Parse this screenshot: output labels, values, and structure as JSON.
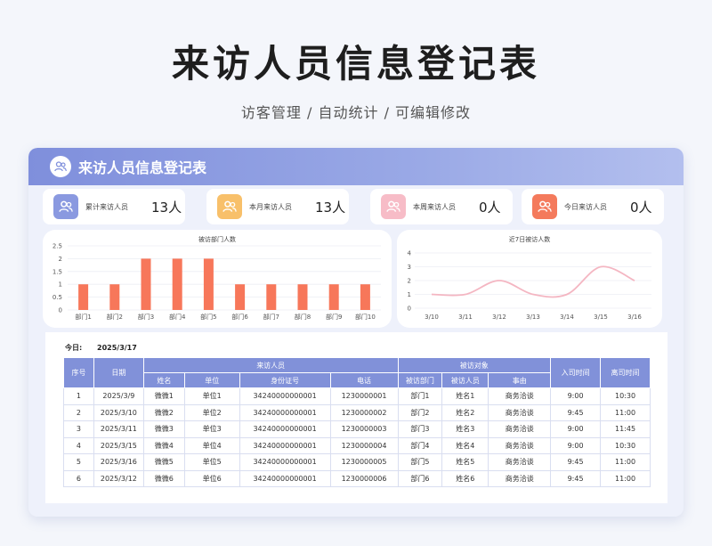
{
  "hero": {
    "title": "来访人员信息登记表",
    "subtitle": "访客管理 / 自动统计 /  可编辑修改"
  },
  "panel": {
    "title": "来访人员信息登记表"
  },
  "stats": [
    {
      "label": "累计来访人员",
      "value": "13人",
      "icon": "users-icon",
      "color": "#7f8fdc"
    },
    {
      "label": "本月来访人员",
      "value": "13人",
      "icon": "users-icon",
      "color": "#f7b955"
    },
    {
      "label": "本周来访人员",
      "value": "0人",
      "icon": "users-icon",
      "color": "#f6a9b8"
    },
    {
      "label": "今日来访人员",
      "value": "0人",
      "icon": "users-icon",
      "color": "#f47a5c"
    }
  ],
  "chart_data": [
    {
      "type": "bar",
      "title": "被访部门人数",
      "categories": [
        "部门1",
        "部门2",
        "部门3",
        "部门4",
        "部门5",
        "部门6",
        "部门7",
        "部门8",
        "部门9",
        "部门10"
      ],
      "values": [
        1,
        1,
        2,
        2,
        2,
        1,
        1,
        1,
        1,
        1
      ],
      "yticks": [
        "0",
        "0.5",
        "1",
        "1.5",
        "2",
        "2.5"
      ],
      "ylim": [
        0,
        2.5
      ],
      "color": "#f7775a",
      "grid": true
    },
    {
      "type": "line",
      "title": "近7日被访人数",
      "categories": [
        "3/10",
        "3/11",
        "3/12",
        "3/13",
        "3/14",
        "3/15",
        "3/16"
      ],
      "values": [
        1,
        1,
        2,
        1,
        1,
        3,
        2
      ],
      "yticks": [
        "0",
        "1",
        "2",
        "3",
        "4"
      ],
      "ylim": [
        0,
        4
      ],
      "color": "#f4b6c2",
      "grid": true
    }
  ],
  "table": {
    "today_label": "今日:",
    "today_value": "2025/3/17",
    "headers": {
      "index": "序号",
      "date": "日期",
      "visitor_group": "来访人员",
      "name": "姓名",
      "unit": "单位",
      "id": "身份证号",
      "phone": "电话",
      "target_group": "被访对象",
      "dept": "被访部门",
      "person": "被访人员",
      "reason": "事由",
      "in_time": "入司时间",
      "out_time": "离司时间"
    },
    "rows": [
      [
        "1",
        "2025/3/9",
        "微微1",
        "单位1",
        "34240000000001",
        "1230000001",
        "部门1",
        "姓名1",
        "商务洽谈",
        "9:00",
        "10:30"
      ],
      [
        "2",
        "2025/3/10",
        "微微2",
        "单位2",
        "34240000000001",
        "1230000002",
        "部门2",
        "姓名2",
        "商务洽谈",
        "9:45",
        "11:00"
      ],
      [
        "3",
        "2025/3/11",
        "微微3",
        "单位3",
        "34240000000001",
        "1230000003",
        "部门3",
        "姓名3",
        "商务洽谈",
        "9:00",
        "11:45"
      ],
      [
        "4",
        "2025/3/15",
        "微微4",
        "单位4",
        "34240000000001",
        "1230000004",
        "部门4",
        "姓名4",
        "商务洽谈",
        "9:00",
        "10:30"
      ],
      [
        "5",
        "2025/3/16",
        "微微5",
        "单位5",
        "34240000000001",
        "1230000005",
        "部门5",
        "姓名5",
        "商务洽谈",
        "9:45",
        "11:00"
      ],
      [
        "6",
        "2025/3/12",
        "微微6",
        "单位6",
        "34240000000001",
        "1230000006",
        "部门6",
        "姓名6",
        "商务洽谈",
        "9:45",
        "11:00"
      ]
    ]
  }
}
